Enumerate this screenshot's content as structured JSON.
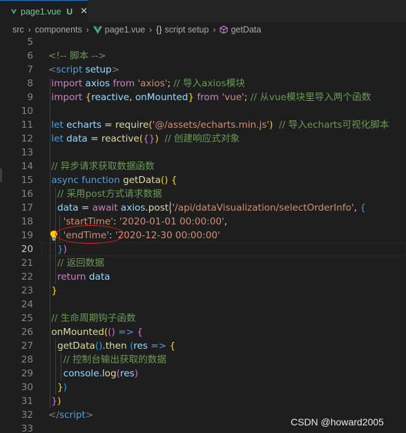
{
  "tab": {
    "title": "page1.vue",
    "status": "U",
    "close": "✕"
  },
  "breadcrumb": {
    "items": [
      "src",
      "components",
      "page1.vue",
      "script setup",
      "getData"
    ],
    "braces": "{}"
  },
  "editor": {
    "active_line": "20",
    "lines": [
      {
        "n": "5",
        "t": []
      },
      {
        "n": "6",
        "t": [
          [
            "c-cmt",
            "<!-- 脚本 -->"
          ]
        ]
      },
      {
        "n": "7",
        "t": [
          [
            "c-tagb",
            "<"
          ],
          [
            "c-tag",
            "script"
          ],
          [
            "c-pl",
            " "
          ],
          [
            "c-var",
            "setup"
          ],
          [
            "c-tagb",
            ">"
          ]
        ]
      },
      {
        "n": "8",
        "t": [
          [
            "c-pl",
            " "
          ],
          [
            "c-kw",
            "import"
          ],
          [
            "c-pl",
            " "
          ],
          [
            "c-var",
            "axios"
          ],
          [
            "c-pl",
            " "
          ],
          [
            "c-kw",
            "from"
          ],
          [
            "c-pl",
            " "
          ],
          [
            "c-str",
            "'axios'"
          ],
          [
            "c-pl",
            "; "
          ],
          [
            "c-cmt",
            "// 导入axios模块"
          ]
        ]
      },
      {
        "n": "9",
        "t": [
          [
            "c-pl",
            " "
          ],
          [
            "c-kw",
            "import"
          ],
          [
            "c-pl",
            " "
          ],
          [
            "c-b1",
            "{"
          ],
          [
            "c-var",
            "reactive"
          ],
          [
            "c-pl",
            ", "
          ],
          [
            "c-var",
            "onMounted"
          ],
          [
            "c-b1",
            "}"
          ],
          [
            "c-pl",
            " "
          ],
          [
            "c-kw",
            "from"
          ],
          [
            "c-pl",
            " "
          ],
          [
            "c-str",
            "'vue'"
          ],
          [
            "c-pl",
            "; "
          ],
          [
            "c-cmt",
            "// 从vue模块里导入两个函数"
          ]
        ]
      },
      {
        "n": "10",
        "t": []
      },
      {
        "n": "11",
        "t": [
          [
            "c-pl",
            " "
          ],
          [
            "c-decl",
            "let"
          ],
          [
            "c-pl",
            " "
          ],
          [
            "c-var",
            "echarts"
          ],
          [
            "c-pl",
            " = "
          ],
          [
            "c-fn",
            "require"
          ],
          [
            "c-b1",
            "("
          ],
          [
            "c-str",
            "'@/assets/echarts.min.js'"
          ],
          [
            "c-b1",
            ")"
          ],
          [
            "c-pl",
            "  "
          ],
          [
            "c-cmt",
            "// 导入echarts可视化脚本"
          ]
        ]
      },
      {
        "n": "12",
        "t": [
          [
            "c-pl",
            " "
          ],
          [
            "c-decl",
            "let"
          ],
          [
            "c-pl",
            " "
          ],
          [
            "c-var",
            "data"
          ],
          [
            "c-pl",
            " = "
          ],
          [
            "c-fn",
            "reactive"
          ],
          [
            "c-b1",
            "("
          ],
          [
            "c-b2",
            "{}"
          ],
          [
            "c-b1",
            ")"
          ],
          [
            "c-pl",
            "  "
          ],
          [
            "c-cmt",
            "// 创建响应式对象"
          ]
        ]
      },
      {
        "n": "13",
        "t": []
      },
      {
        "n": "14",
        "t": [
          [
            "c-pl",
            " "
          ],
          [
            "c-cmt",
            "// 异步请求获取数据函数"
          ]
        ]
      },
      {
        "n": "15",
        "t": [
          [
            "c-pl",
            " "
          ],
          [
            "c-decl",
            "async"
          ],
          [
            "c-pl",
            " "
          ],
          [
            "c-decl",
            "function"
          ],
          [
            "c-pl",
            " "
          ],
          [
            "c-fn",
            "getData"
          ],
          [
            "c-b1",
            "()"
          ],
          [
            "c-pl",
            " "
          ],
          [
            "c-b1",
            "{"
          ]
        ]
      },
      {
        "n": "16",
        "t": [
          [
            "c-pl",
            "   "
          ],
          [
            "c-cmt",
            "// 采用post方式请求数据"
          ]
        ]
      },
      {
        "n": "17",
        "t": [
          [
            "c-pl",
            "   "
          ],
          [
            "c-var",
            "data"
          ],
          [
            "c-pl",
            " = "
          ],
          [
            "c-kw",
            "await"
          ],
          [
            "c-pl",
            " "
          ],
          [
            "c-var",
            "axios"
          ],
          [
            "c-pl",
            "."
          ],
          [
            "c-fn",
            "post"
          ],
          [
            "c-b2",
            "("
          ],
          [
            "c-str",
            "'/api/dataVisualization/selectOrderInfo'"
          ],
          [
            "c-pl",
            ", "
          ],
          [
            "c-b3",
            "{"
          ]
        ]
      },
      {
        "n": "18",
        "t": [
          [
            "c-pl",
            "     "
          ],
          [
            "c-str",
            "'startTime'"
          ],
          [
            "c-pl",
            ": "
          ],
          [
            "c-str",
            "'2020-01-01 00:00:00'"
          ],
          [
            "c-pl",
            ","
          ]
        ]
      },
      {
        "n": "19",
        "t": [
          [
            "c-pl",
            "     "
          ],
          [
            "c-str",
            "'endTime'"
          ],
          [
            "c-pl",
            ": "
          ],
          [
            "c-str",
            "'2020-12-30 00:00:00'"
          ]
        ]
      },
      {
        "n": "20",
        "t": [
          [
            "c-pl",
            "   "
          ],
          [
            "c-b3",
            "}"
          ],
          [
            "c-b2",
            ")"
          ]
        ]
      },
      {
        "n": "21",
        "t": [
          [
            "c-pl",
            "   "
          ],
          [
            "c-cmt",
            "// 返回数据"
          ]
        ]
      },
      {
        "n": "22",
        "t": [
          [
            "c-pl",
            "   "
          ],
          [
            "c-kw",
            "return"
          ],
          [
            "c-pl",
            " "
          ],
          [
            "c-var",
            "data"
          ]
        ]
      },
      {
        "n": "23",
        "t": [
          [
            "c-pl",
            " "
          ],
          [
            "c-b1",
            "}"
          ]
        ]
      },
      {
        "n": "24",
        "t": []
      },
      {
        "n": "25",
        "t": [
          [
            "c-pl",
            " "
          ],
          [
            "c-cmt",
            "// 生命周期钩子函数"
          ]
        ]
      },
      {
        "n": "26",
        "t": [
          [
            "c-pl",
            " "
          ],
          [
            "c-fn",
            "onMounted"
          ],
          [
            "c-b1",
            "("
          ],
          [
            "c-b2",
            "()"
          ],
          [
            "c-pl",
            " "
          ],
          [
            "c-decl",
            "=>"
          ],
          [
            "c-pl",
            " "
          ],
          [
            "c-b2",
            "{"
          ]
        ]
      },
      {
        "n": "27",
        "t": [
          [
            "c-pl",
            "   "
          ],
          [
            "c-fn",
            "getData"
          ],
          [
            "c-b3",
            "()"
          ],
          [
            "c-pl",
            "."
          ],
          [
            "c-fn",
            "then"
          ],
          [
            "c-pl",
            " "
          ],
          [
            "c-b3",
            "("
          ],
          [
            "c-var",
            "res"
          ],
          [
            "c-pl",
            " "
          ],
          [
            "c-decl",
            "=>"
          ],
          [
            "c-pl",
            " "
          ],
          [
            "c-b1",
            "{"
          ]
        ]
      },
      {
        "n": "28",
        "t": [
          [
            "c-pl",
            "     "
          ],
          [
            "c-cmt",
            "// 控制台输出获取的数据"
          ]
        ]
      },
      {
        "n": "29",
        "t": [
          [
            "c-pl",
            "     "
          ],
          [
            "c-var",
            "console"
          ],
          [
            "c-pl",
            "."
          ],
          [
            "c-fn",
            "log"
          ],
          [
            "c-b2",
            "("
          ],
          [
            "c-var",
            "res"
          ],
          [
            "c-b2",
            ")"
          ]
        ]
      },
      {
        "n": "30",
        "t": [
          [
            "c-pl",
            "   "
          ],
          [
            "c-b1",
            "}"
          ],
          [
            "c-b3",
            ")"
          ]
        ]
      },
      {
        "n": "31",
        "t": [
          [
            "c-pl",
            " "
          ],
          [
            "c-b2",
            "}"
          ],
          [
            "c-b1",
            ")"
          ]
        ]
      },
      {
        "n": "32",
        "t": [
          [
            "c-tagb",
            "</"
          ],
          [
            "c-tag",
            "script"
          ],
          [
            "c-tagb",
            ">"
          ]
        ]
      },
      {
        "n": "33",
        "t": []
      }
    ]
  },
  "watermark": "CSDN @howard2005",
  "colors": {
    "accent": "#0078d4",
    "untracked": "#73c991",
    "highlight": "#e01e1e"
  },
  "icons": [
    "vue-icon",
    "close-icon",
    "chevron-right-icon",
    "braces-icon",
    "method-cube-icon",
    "lightbulb-icon"
  ]
}
